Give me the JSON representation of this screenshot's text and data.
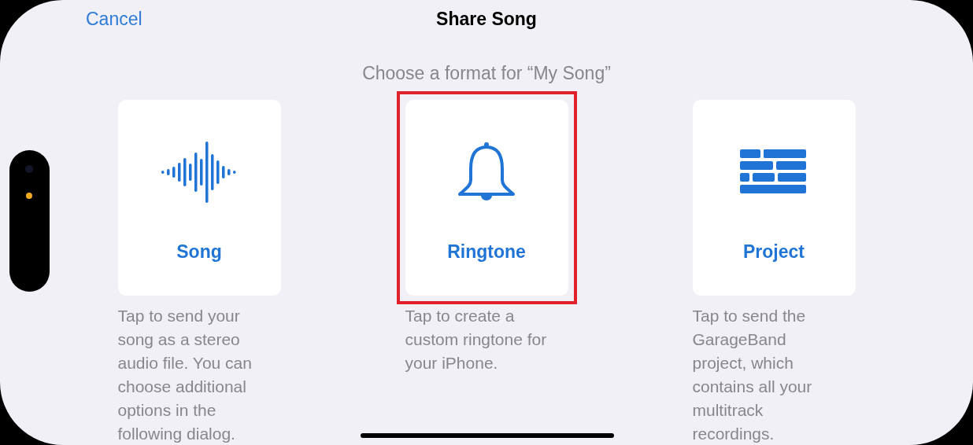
{
  "navigation": {
    "cancel": "Cancel",
    "title": "Share Song"
  },
  "prompt": "Choose a format for “My Song”",
  "options": [
    {
      "label": "Song",
      "description": "Tap to send your\nsong as a stereo\naudio file. You can\nchoose additional\noptions in the\nfollowing dialog.",
      "highlighted": false
    },
    {
      "label": "Ringtone",
      "description": "Tap to create a\ncustom ringtone for\nyour iPhone.",
      "highlighted": true
    },
    {
      "label": "Project",
      "description": "Tap to send the\nGarageBand\nproject, which\ncontains all your\nmultitrack\nrecordings.",
      "highlighted": false
    }
  ]
}
